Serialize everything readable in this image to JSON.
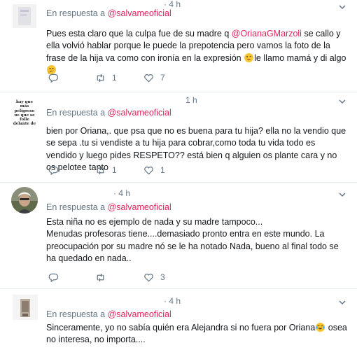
{
  "tweets": [
    {
      "time": "· 4 h",
      "reply_prefix": "En respuesta a",
      "reply_handle": "@salvameoficial",
      "text_1": "Pues esta claro que la culpa fue de su madre q ",
      "mention": "@OrianaGMarzoli",
      "text_2": " se callo y ella volvió hablar porque le puede la prepotencia pero vamos la foto de la frase de la hija va como con ironía en la expresión ",
      "text_3": "le llamo mamá y di algo ",
      "emoji_1": "winking-face-tongue-emoji",
      "emoji_2": "thinking-face-emoji",
      "retweets": "1",
      "likes": "7",
      "accent": "#e0245e"
    },
    {
      "time": "1 h",
      "reply_prefix": "En respuesta a",
      "reply_handle": "@salvameoficial",
      "text": "bien por Oriana,. que psa que no es buena para tu hija? ella no la vendio que se sepa .tu si vendiste a tu hija para cobrar,como toda tu vida  todo es vendido y luego pides RESPETO?? está bien q alguien os plante cara y no os pelotee tanto",
      "avatar_text": "hay que\nmás peligroso\nue que se folle\ndelante de",
      "retweets": "1",
      "likes": "1"
    },
    {
      "time": "· 4 h",
      "reply_prefix": "En respuesta a",
      "reply_handle": "@salvameoficial",
      "text": "Esta niña no es ejemplo de nada y su madre tampoco...\nMenudas profesoras tiene....demasiado pronto entra en este mundo. La preocupación por su madre nó se le ha notado Nada, bueno al final todo se ha quedado en nada..",
      "likes": "3"
    },
    {
      "time": "· 4 h",
      "reply_prefix": "En respuesta a",
      "reply_handle": "@salvameoficial",
      "text_1": "Sinceramente, yo no sabía quién era Alejandra si no fuera por Oriana",
      "text_2": " osea no interesa, no importa....",
      "emoji": "face-with-tears-of-joy-emoji"
    }
  ]
}
